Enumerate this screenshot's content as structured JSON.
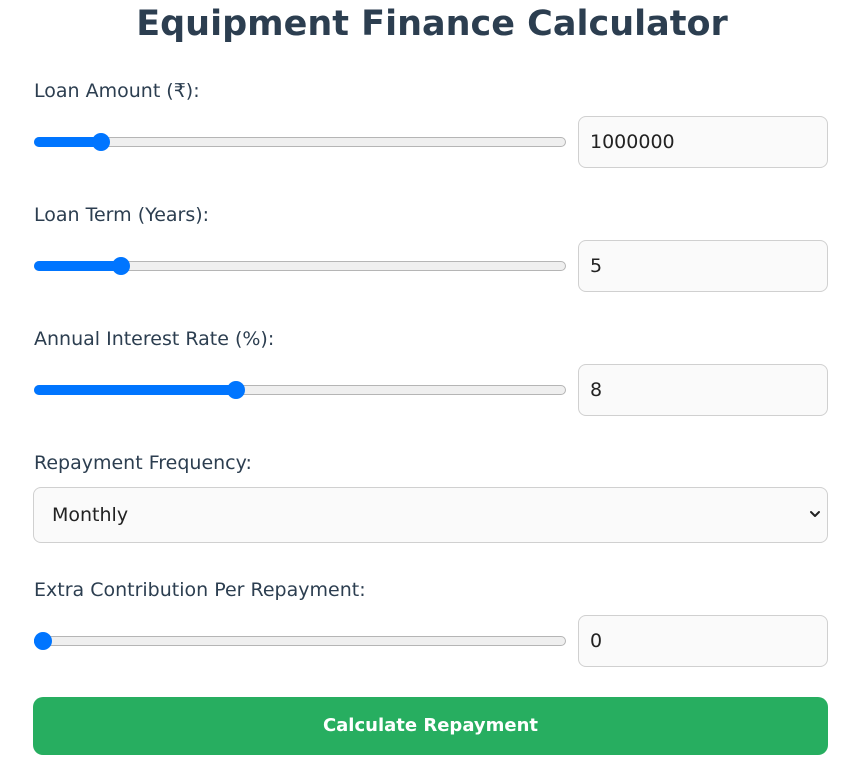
{
  "page": {
    "title": "Equipment Finance Calculator"
  },
  "loan_amount": {
    "label": "Loan Amount (₹):",
    "value": "1000000",
    "slider_fraction": 0.113
  },
  "loan_term": {
    "label": "Loan Term (Years):",
    "value": "5",
    "slider_fraction": 0.152
  },
  "interest_rate": {
    "label": "Annual Interest Rate (%):",
    "value": "8",
    "slider_fraction": 0.376
  },
  "repayment_frequency": {
    "label": "Repayment Frequency:",
    "selected": "Monthly"
  },
  "extra_contribution": {
    "label": "Extra Contribution Per Repayment:",
    "value": "0",
    "slider_fraction": 0.0
  },
  "actions": {
    "calculate_label": "Calculate Repayment"
  },
  "colors": {
    "accent": "#0075ff",
    "button": "#27ae60",
    "text": "#2c3e50"
  },
  "icons": {
    "select_indicator": "chevron-down-icon"
  }
}
